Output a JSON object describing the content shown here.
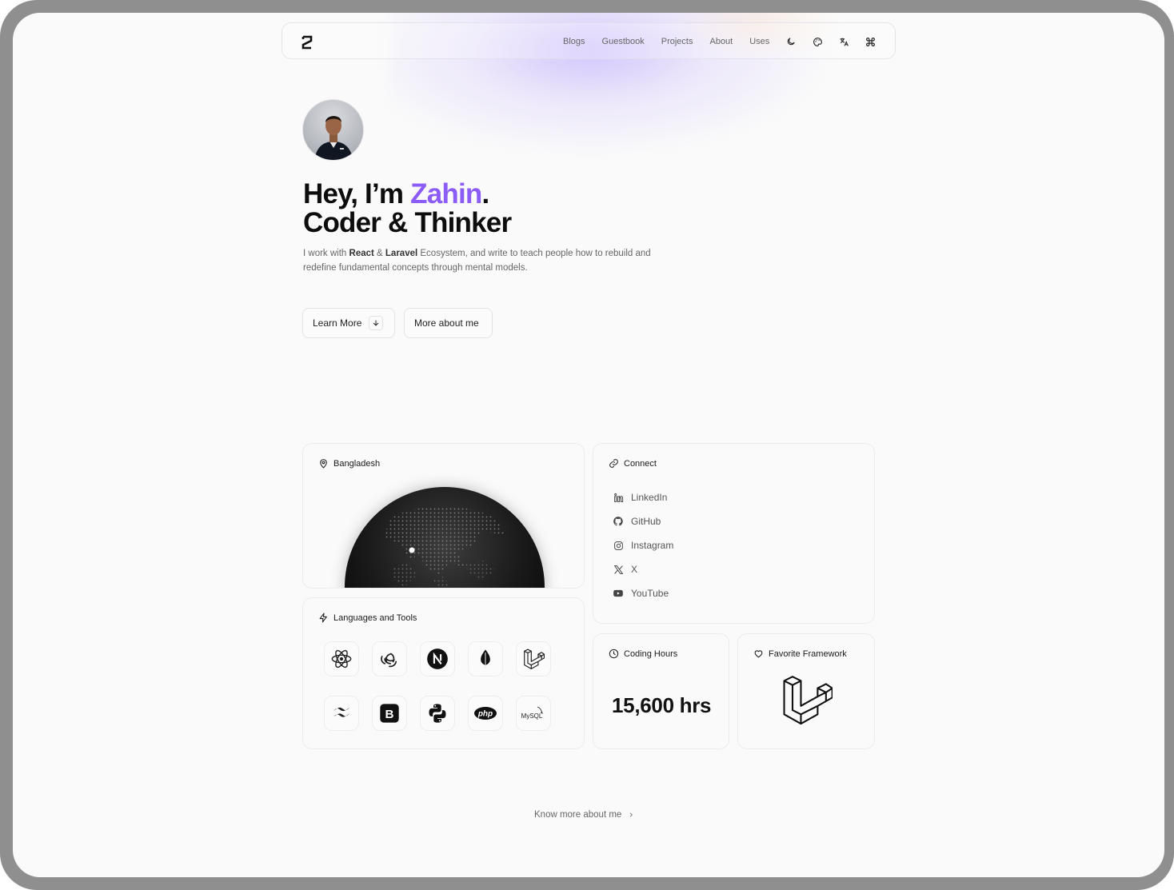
{
  "nav": {
    "links": [
      "Blogs",
      "Guestbook",
      "Projects",
      "About",
      "Uses"
    ],
    "icons": [
      "moon-icon",
      "palette-icon",
      "translate-icon",
      "command-icon"
    ]
  },
  "hero": {
    "line1_prefix": "Hey, I’m ",
    "name": "Zahin",
    "line1_suffix": ".",
    "line2": "Coder & Thinker",
    "intro_a": "I work with ",
    "intro_react": "React",
    "intro_b": " & ",
    "intro_laravel": "Laravel",
    "intro_c": " Ecosystem, and write to teach people how to rebuild and redefine fundamental concepts through mental models.",
    "learn_more": "Learn More",
    "more_about": "More about me"
  },
  "location": {
    "title": "Bangladesh"
  },
  "tools": {
    "title": "Languages and Tools",
    "items": [
      "react-icon",
      "redux-icon",
      "nextjs-icon",
      "mongodb-icon",
      "laravel-icon",
      "tailwind-icon",
      "bootstrap-icon",
      "python-icon",
      "php-icon",
      "mysql-icon"
    ]
  },
  "connect": {
    "title": "Connect",
    "items": [
      "LinkedIn",
      "GitHub",
      "Instagram",
      "X",
      "YouTube"
    ]
  },
  "hours": {
    "title": "Coding Hours",
    "value": "15,600 hrs"
  },
  "favorite": {
    "title": "Favorite Framework"
  },
  "footer": {
    "know_more": "Know more about me"
  },
  "colors": {
    "accent": "#8b5cf6",
    "background": "#fafafa"
  }
}
